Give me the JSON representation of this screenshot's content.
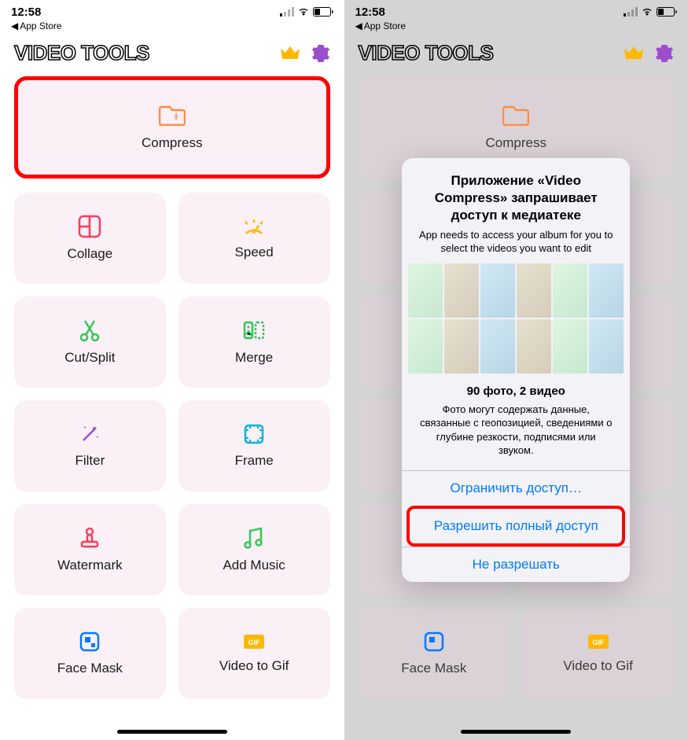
{
  "status": {
    "time": "12:58",
    "back": "App Store"
  },
  "app": {
    "title": "VIDEO TOOLS"
  },
  "tiles": {
    "hero": {
      "label": "Compress"
    },
    "items": [
      {
        "label": "Collage"
      },
      {
        "label": "Speed"
      },
      {
        "label": "Cut/Split"
      },
      {
        "label": "Merge"
      },
      {
        "label": "Filter"
      },
      {
        "label": "Frame"
      },
      {
        "label": "Watermark"
      },
      {
        "label": "Add Music"
      },
      {
        "label": "Face Mask"
      },
      {
        "label": "Video to Gif"
      }
    ]
  },
  "dialog": {
    "title": "Приложение «Video Compress» запрашивает доступ к медиатеке",
    "subtitle": "App needs to access your album for you to select the videos you want to edit",
    "count": "90 фото, 2 видео",
    "note": "Фото могут содержать данные, связанные с геопозицией, сведениями о глубине резкости, подписями или звуком.",
    "buttons": {
      "limit": "Ограничить доступ…",
      "allow": "Разрешить полный доступ",
      "deny": "Не разрешать"
    }
  }
}
